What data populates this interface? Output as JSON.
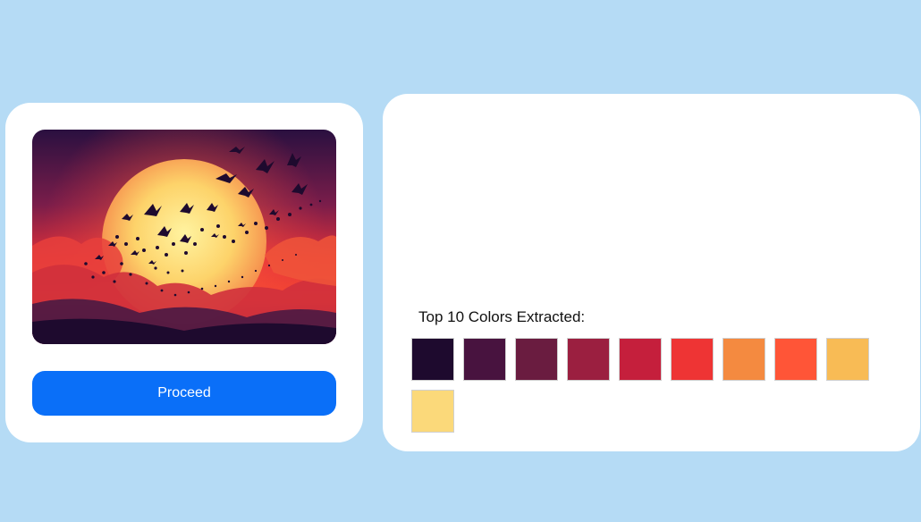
{
  "proceed_label": "Proceed",
  "colors": {
    "heading": "Top 10 Colors Extracted:",
    "swatches": [
      "#1e0a2e",
      "#48133f",
      "#6a1c40",
      "#9b1f40",
      "#c51f3c",
      "#ee3434",
      "#f48a40",
      "#ff5537",
      "#f8bb55",
      "#fbd97a"
    ]
  },
  "image": {
    "description_icon": "sunset-birds-image"
  }
}
